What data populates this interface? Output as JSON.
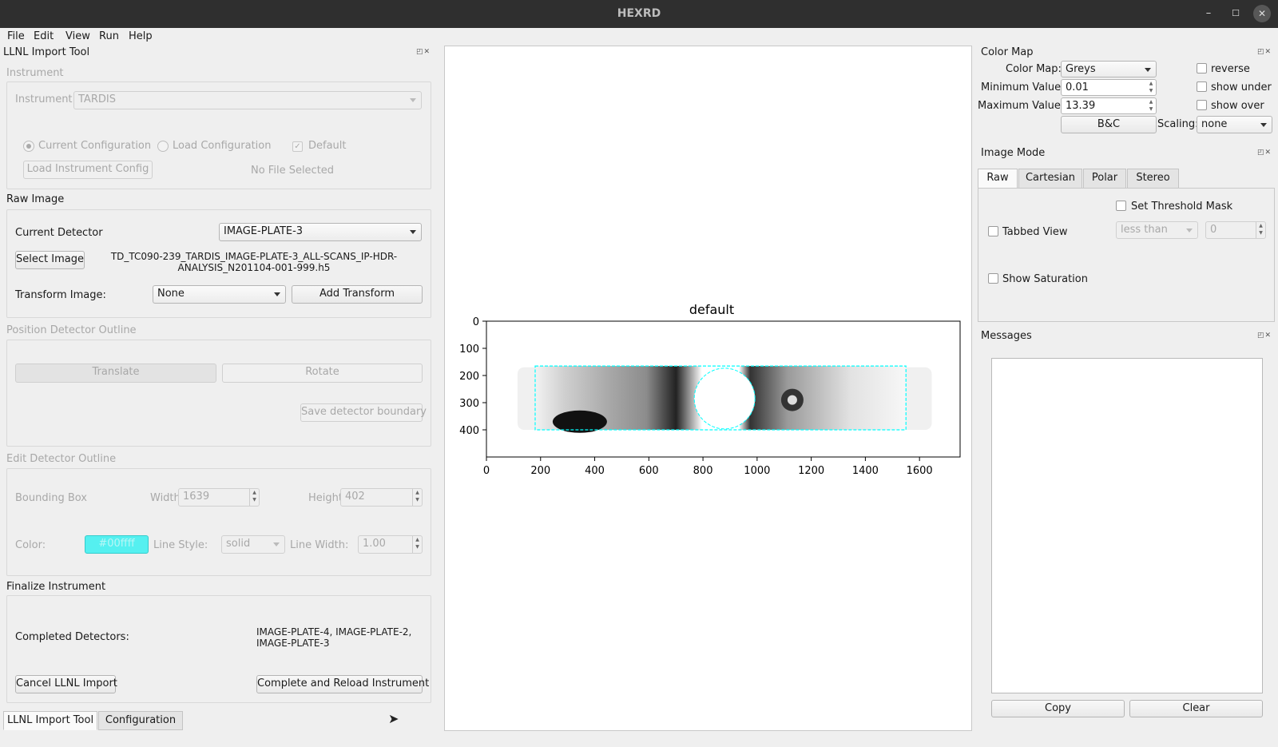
{
  "window": {
    "title": "HEXRD",
    "minimize": "–",
    "maximize": "☐",
    "close": "✕"
  },
  "menubar": [
    "File",
    "Edit",
    "View",
    "Run",
    "Help"
  ],
  "left": {
    "dock_title": "LLNL Import Tool",
    "dock_btns": "◰✕",
    "instrument": {
      "group": "Instrument",
      "label": "Instrument",
      "value": "TARDIS",
      "current_config": "Current Configuration",
      "load_config": "Load Configuration",
      "default": "Default",
      "load_button": "Load Instrument Config",
      "no_file": "No File Selected"
    },
    "raw_image": {
      "group": "Raw Image",
      "current_detector_label": "Current Detector",
      "current_detector": "IMAGE-PLATE-3",
      "select_button": "Select Image",
      "file_line1": "TD_TC090-239_TARDIS_IMAGE-PLATE-3_ALL-SCANS_IP-HDR-",
      "file_line2": "ANALYSIS_N201104-001-999.h5",
      "transform_label": "Transform Image:",
      "transform_value": "None",
      "add_transform": "Add Transform"
    },
    "position": {
      "group": "Position Detector Outline",
      "translate": "Translate",
      "rotate": "Rotate",
      "save_boundary": "Save detector boundary"
    },
    "edit": {
      "group": "Edit Detector Outline",
      "bbox_label": "Bounding Box",
      "width_label": "Width",
      "width": "1639",
      "height_label": "Height",
      "height": "402",
      "color_label": "Color:",
      "color": "#00ffff",
      "line_style_label": "Line Style:",
      "line_style": "solid",
      "line_width_label": "Line Width:",
      "line_width": "1.00"
    },
    "finalize": {
      "group": "Finalize Instrument",
      "completed_label": "Completed Detectors:",
      "completed_line1": "IMAGE-PLATE-4, IMAGE-PLATE-2,",
      "completed_line2": "IMAGE-PLATE-3",
      "cancel": "Cancel LLNL Import",
      "complete": "Complete and Reload Instrument"
    },
    "tabs": [
      "LLNL Import Tool",
      "Configuration"
    ]
  },
  "chart_data": {
    "type": "heatmap",
    "title": "default",
    "xticks": [
      "0",
      "200",
      "400",
      "600",
      "800",
      "1000",
      "1200",
      "1400",
      "1600"
    ],
    "yticks": [
      "0",
      "100",
      "200",
      "300",
      "400"
    ],
    "xlim": [
      0,
      1750
    ],
    "ylim": [
      500,
      0
    ],
    "colormap": "Greys",
    "outline_color": "#00ffff"
  },
  "right": {
    "colormap": {
      "title": "Color Map",
      "dock_btns": "◰✕",
      "map_label": "Color Map:",
      "map_value": "Greys",
      "min_label": "Minimum Value:",
      "min_value": "0.01",
      "max_label": "Maximum Value:",
      "max_value": "13.39",
      "reverse": "reverse",
      "show_under": "show under",
      "show_over": "show over",
      "bc": "B&C",
      "scaling_label": "Scaling:",
      "scaling_value": "none"
    },
    "imagemode": {
      "title": "Image Mode",
      "dock_btns": "◰✕",
      "tabs": [
        "Raw",
        "Cartesian",
        "Polar",
        "Stereo"
      ],
      "threshold": "Set Threshold Mask",
      "tabbed": "Tabbed View",
      "comparison": "less than",
      "threshold_value": "0",
      "saturation": "Show Saturation"
    },
    "messages": {
      "title": "Messages",
      "dock_btns": "◰✕",
      "copy": "Copy",
      "clear": "Clear"
    }
  }
}
